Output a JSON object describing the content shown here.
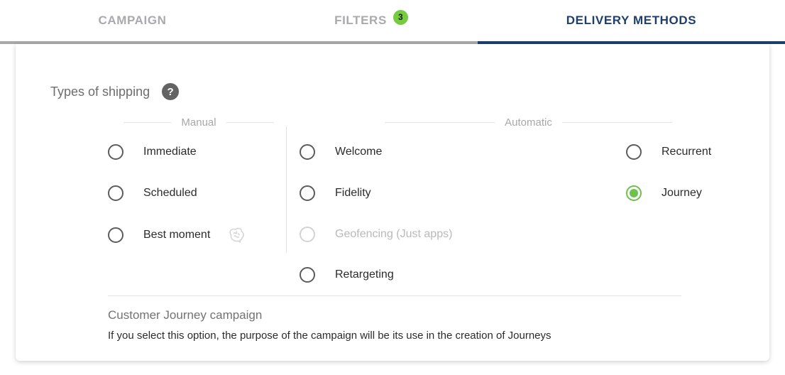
{
  "tabs": [
    {
      "label": "CAMPAIGN",
      "active": false,
      "badge": null
    },
    {
      "label": "FILTERS",
      "active": false,
      "badge": "3"
    },
    {
      "label": "DELIVERY METHODS",
      "active": true,
      "badge": null
    }
  ],
  "colors": {
    "active_tab": "#1d3f6e",
    "inactive_tab": "#a9a9ae",
    "badge_green": "#76cc3f",
    "selected_radio_green": "#6cc24a",
    "inactive_underline": "#a8a8a8"
  },
  "section": {
    "title": "Types of shipping",
    "help_icon": "help-question-icon",
    "help_glyph": "?"
  },
  "groups": {
    "manual": {
      "label": "Manual"
    },
    "automatic": {
      "label": "Automatic"
    }
  },
  "options": {
    "manual": [
      {
        "label": "Immediate",
        "selected": false,
        "disabled": false,
        "icon": null
      },
      {
        "label": "Scheduled",
        "selected": false,
        "disabled": false,
        "icon": null
      },
      {
        "label": "Best moment",
        "selected": false,
        "disabled": false,
        "icon": "brain-ai-icon"
      }
    ],
    "automatic_col1": [
      {
        "label": "Welcome",
        "selected": false,
        "disabled": false,
        "icon": null
      },
      {
        "label": "Fidelity",
        "selected": false,
        "disabled": false,
        "icon": null
      },
      {
        "label": "Geofencing (Just apps)",
        "selected": false,
        "disabled": true,
        "icon": null
      },
      {
        "label": "Retargeting",
        "selected": false,
        "disabled": false,
        "icon": null
      }
    ],
    "automatic_col2": [
      {
        "label": "Recurrent",
        "selected": false,
        "disabled": false,
        "icon": null
      },
      {
        "label": "Journey",
        "selected": true,
        "disabled": false,
        "icon": null
      }
    ]
  },
  "footer": {
    "title": "Customer Journey campaign",
    "description": "If you select this option, the purpose of the campaign will be its use in the creation of Journeys"
  }
}
